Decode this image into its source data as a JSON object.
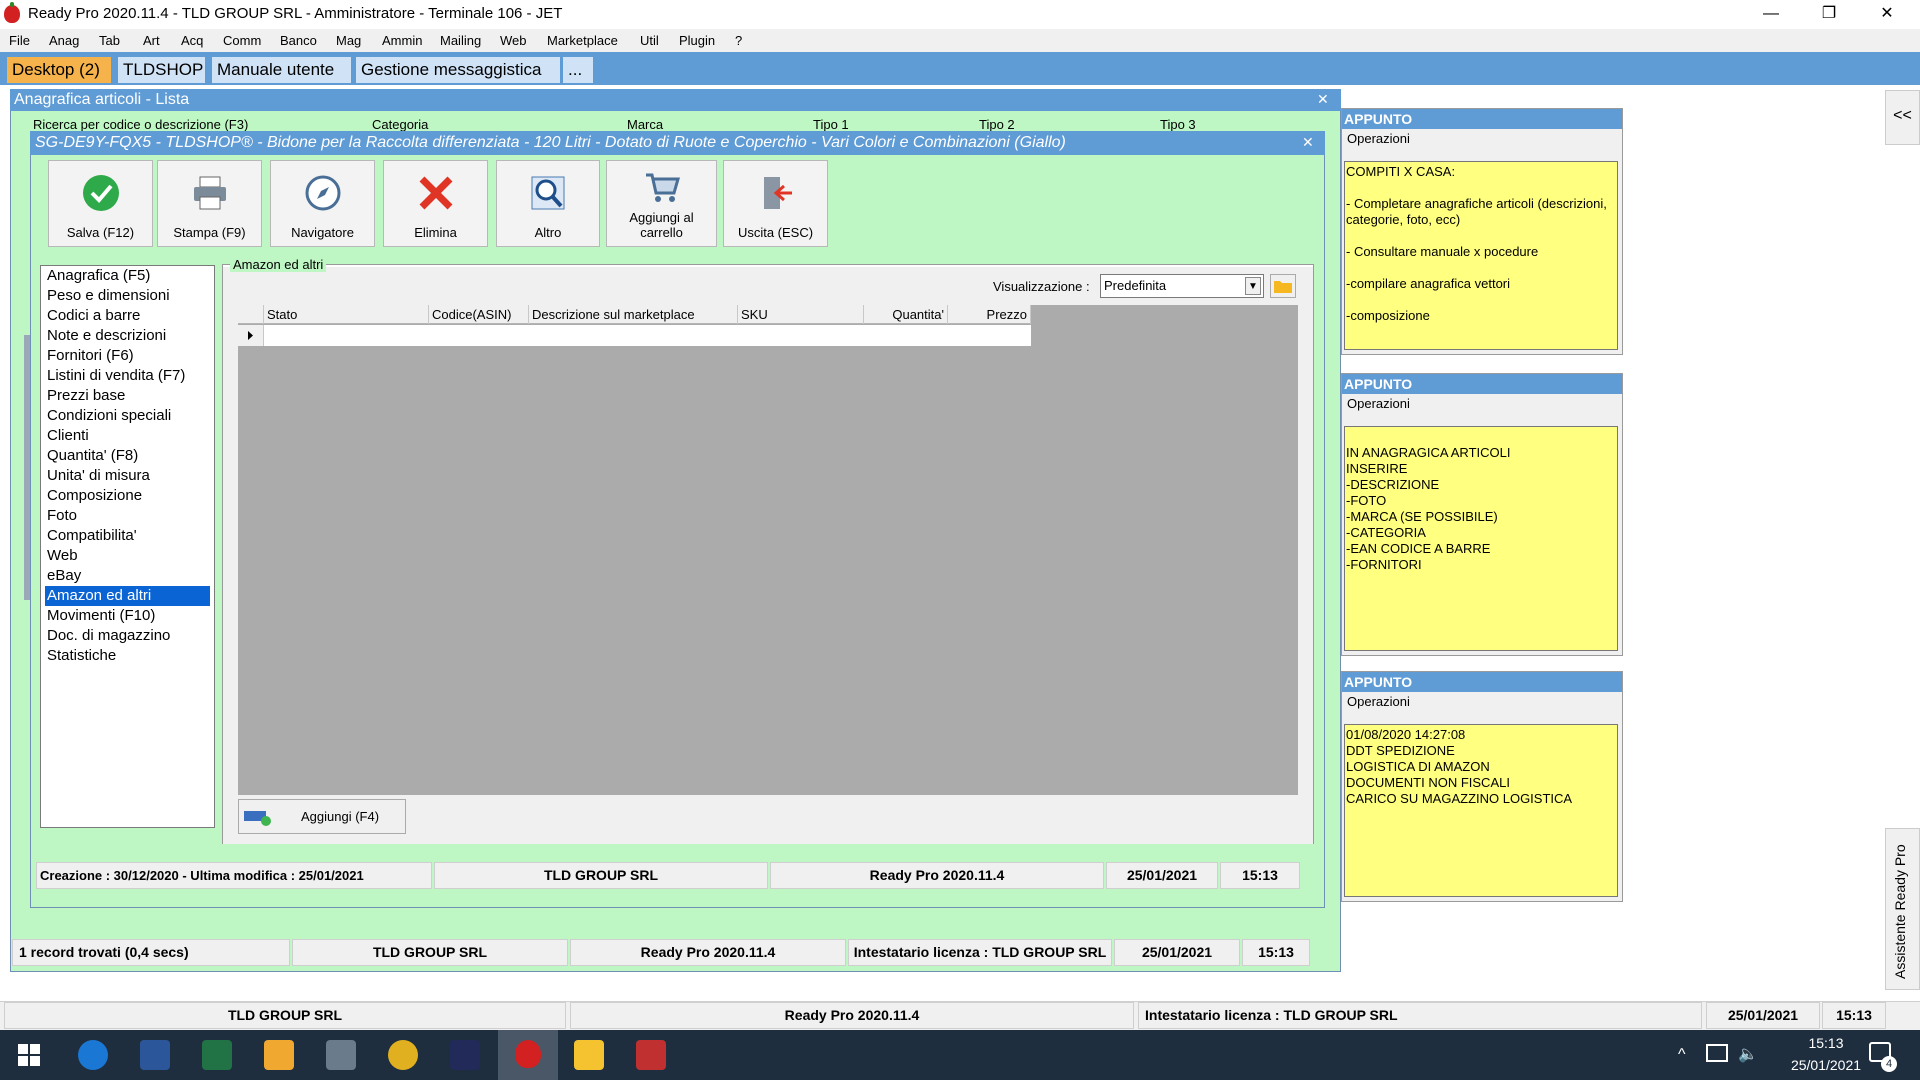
{
  "window": {
    "title": "Ready Pro 2020.11.4 - TLD GROUP SRL - Amministratore - Terminale 106 - JET",
    "minimize": "—",
    "restore": "❐",
    "close": "✕"
  },
  "menu": [
    "File",
    "Anag",
    "Tab",
    "Art",
    "Acq",
    "Comm",
    "Banco",
    "Mag",
    "Ammin",
    "Mailing",
    "Web",
    "Marketplace",
    "Util",
    "Plugin",
    "?"
  ],
  "tabs": [
    "Desktop (2)",
    "TLDSHOP",
    "Manuale utente",
    "Gestione messaggistica",
    "..."
  ],
  "list_window": {
    "title": "Anagrafica articoli  - Lista",
    "close": "✕",
    "columns": [
      "Ricerca per codice o descrizione (F3)",
      "Categoria",
      "Marca",
      "Tipo 1",
      "Tipo 2",
      "Tipo 3"
    ],
    "status": [
      "1 record trovati (0,4 secs)",
      "TLD GROUP SRL",
      "Ready Pro 2020.11.4",
      "Intestatario licenza : TLD GROUP SRL",
      "25/01/2021",
      "15:13"
    ]
  },
  "detail": {
    "title": "SG-DE9Y-FQX5 - TLDSHOP® - Bidone per la Raccolta differenziata - 120 Litri - Dotato di Ruote e Coperchio - Vari Colori e Combinazioni (Giallo)",
    "close": "✕",
    "toolbar": [
      "Salva (F12)",
      "Stampa (F9)",
      "Navigatore",
      "Elimina",
      "Altro",
      "Aggiungi al carrello",
      "Uscita (ESC)"
    ],
    "nav": [
      "Anagrafica (F5)",
      "Peso e dimensioni",
      "Codici a barre",
      "Note e descrizioni",
      "Fornitori (F6)",
      "Listini di vendita (F7)",
      "Prezzi base",
      "Condizioni speciali",
      "Clienti",
      "Quantita' (F8)",
      "Unita' di misura",
      "Composizione",
      "Foto",
      "Compatibilita'",
      "Web",
      "eBay",
      "Amazon ed altri",
      "Movimenti (F10)",
      "Doc. di magazzino",
      "Statistiche"
    ],
    "selected_nav": "Amazon ed altri",
    "group_label": "Amazon ed altri",
    "view_label": "Visualizzazione :",
    "view_value": "Predefinita",
    "grid_columns": [
      "Stato",
      "Codice(ASIN)",
      "Descrizione sul marketplace",
      "SKU",
      "Quantita'",
      "Prezzo"
    ],
    "add_button": "Aggiungi (F4)",
    "status": [
      "Creazione : 30/12/2020 - Ultima modifica : 25/01/2021",
      "TLD GROUP SRL",
      "Ready Pro 2020.11.4",
      "25/01/2021",
      "15:13"
    ]
  },
  "appunti": [
    {
      "title": "APPUNTO",
      "ops": "Operazioni",
      "body": "COMPITI X CASA:\n\n- Completare anagrafiche articoli (descrizioni, categorie, foto, ecc)\n\n- Consultare manuale x pocedure\n\n-compilare anagrafica vettori\n\n-composizione"
    },
    {
      "title": "APPUNTO",
      "ops": "Operazioni",
      "body": "\nIN ANAGRAGICA ARTICOLI\nINSERIRE\n-DESCRIZIONE\n-FOTO\n-MARCA (SE POSSIBILE)\n-CATEGORIA\n-EAN CODICE A BARRE\n-FORNITORI"
    },
    {
      "title": "APPUNTO",
      "ops": "Operazioni",
      "body": "01/08/2020 14:27:08\nDDT SPEDIZIONE\nLOGISTICA DI AMAZON\nDOCUMENTI NON FISCALI\nCARICO SU MAGAZZINO LOGISTICA"
    }
  ],
  "side": {
    "collapse": "<<",
    "assistant": "Assistente Ready Pro"
  },
  "bottom_status": [
    "TLD GROUP SRL",
    "Ready Pro 2020.11.4",
    "Intestatario licenza : TLD GROUP SRL",
    "25/01/2021",
    "15:13"
  ],
  "taskbar": {
    "time": "15:13",
    "date": "25/01/2021",
    "notif_count": "4"
  },
  "colors": {
    "accent": "#5f9bd4",
    "panel": "#bff7c4",
    "note": "#ffff80",
    "selected": "#0a64d4",
    "active_tab": "#f7b34b"
  }
}
